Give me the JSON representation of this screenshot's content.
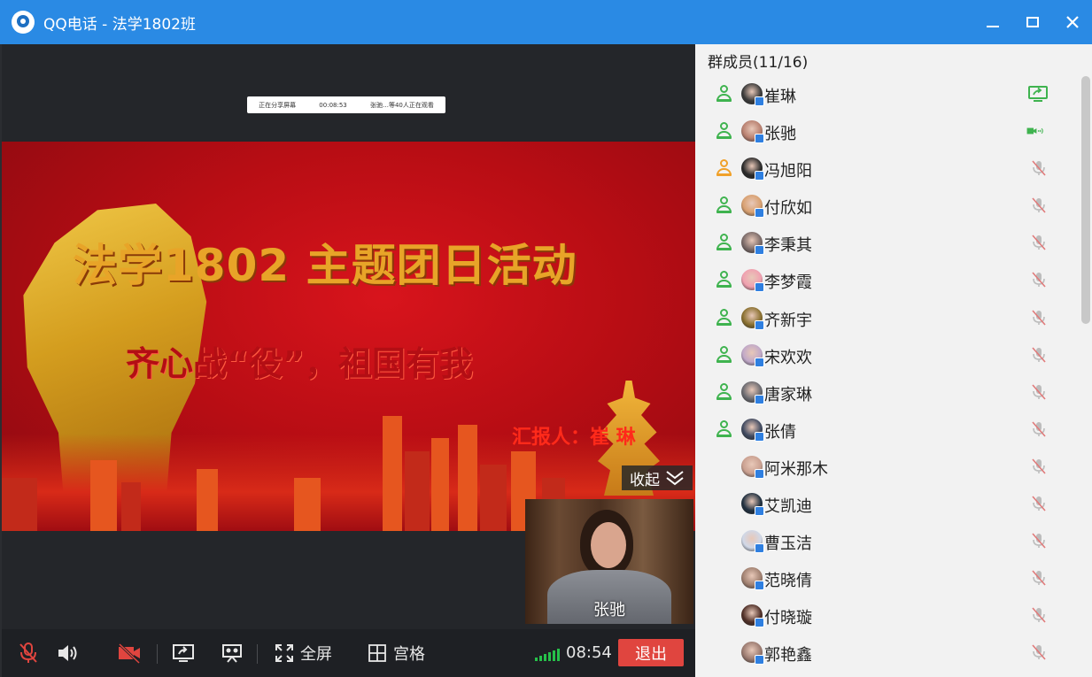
{
  "window": {
    "title": "QQ电话 - 法学1802班",
    "minimize_icon": "minimize-icon",
    "maximize_icon": "maximize-icon",
    "close_icon": "close-icon"
  },
  "share_bar": {
    "status": "正在分享屏幕",
    "duration": "00:08:53",
    "viewers": "张驰…等40人正在观看"
  },
  "slide": {
    "title": "法学1802 主题团日活动",
    "subtitle": "齐心战“役”，祖国有我",
    "reporter": "汇报人：崔 琳"
  },
  "collapse_label": "收起",
  "pip": {
    "name": "张驰"
  },
  "toolbar": {
    "fullscreen_label": "全屏",
    "grid_label": "宫格",
    "time": "08:54",
    "exit_label": "退出",
    "colors": {
      "exit": "#e0453f",
      "signal": "#26c14a",
      "muted": "#e0453f"
    }
  },
  "members": {
    "title": "群成员(11/16)",
    "list": [
      {
        "name": "崔琳",
        "role": "green",
        "status": "screen-share-icon",
        "avatar": "#3a3a3a"
      },
      {
        "name": "张驰",
        "role": "green",
        "status": "camera-speaking-icon",
        "avatar": "#b88070"
      },
      {
        "name": "冯旭阳",
        "role": "orange",
        "status": "mic-muted-icon",
        "avatar": "#2a2a2a"
      },
      {
        "name": "付欣如",
        "role": "green",
        "status": "mic-muted-icon",
        "avatar": "#d8a070"
      },
      {
        "name": "李秉其",
        "role": "green",
        "status": "mic-muted-icon",
        "avatar": "#7a6a68"
      },
      {
        "name": "李梦霞",
        "role": "green",
        "status": "mic-muted-icon",
        "avatar": "#f0a0b0"
      },
      {
        "name": "齐新宇",
        "role": "green",
        "status": "mic-muted-icon",
        "avatar": "#8a7030"
      },
      {
        "name": "宋欢欢",
        "role": "green",
        "status": "mic-muted-icon",
        "avatar": "#c0a8c8"
      },
      {
        "name": "唐家琳",
        "role": "green",
        "status": "mic-muted-icon",
        "avatar": "#6a6a70"
      },
      {
        "name": "张倩",
        "role": "green",
        "status": "mic-muted-icon",
        "avatar": "#404a60"
      },
      {
        "name": "阿米那木",
        "role": "none",
        "status": "mic-muted-icon",
        "avatar": "#caa090"
      },
      {
        "name": "艾凯迪",
        "role": "none",
        "status": "mic-muted-icon",
        "avatar": "#203040"
      },
      {
        "name": "曹玉洁",
        "role": "none",
        "status": "mic-muted-icon",
        "avatar": "#d0d8e8"
      },
      {
        "name": "范晓倩",
        "role": "none",
        "status": "mic-muted-icon",
        "avatar": "#a08070"
      },
      {
        "name": "付晓璇",
        "role": "none",
        "status": "mic-muted-icon",
        "avatar": "#503028"
      },
      {
        "name": "郭艳鑫",
        "role": "none",
        "status": "mic-muted-icon",
        "avatar": "#9a7a70"
      }
    ]
  }
}
